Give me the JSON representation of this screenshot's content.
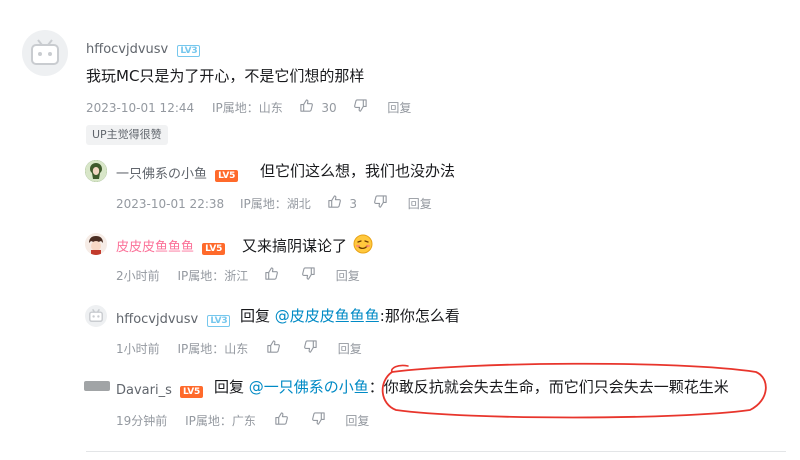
{
  "main_comment": {
    "username": "hffocvjdvusv",
    "level": "LV3",
    "text": "我玩MC只是为了开心，不是它们想的那样",
    "time": "2023-10-01 12:44",
    "ip": "IP属地：山东",
    "likes": "30",
    "reply_label": "回复",
    "up_badge": "UP主觉得很赞"
  },
  "replies": [
    {
      "username": "一只佛系の小鱼",
      "level": "LV5",
      "text": "但它们这么想，我们也没办法",
      "time": "2023-10-01 22:38",
      "ip": "IP属地：湖北",
      "likes": "3",
      "reply_label": "回复"
    },
    {
      "username": "皮皮皮鱼鱼鱼",
      "level": "LV5",
      "text": "又来搞阴谋论了",
      "time": "2小时前",
      "ip": "IP属地：浙江",
      "reply_label": "回复"
    },
    {
      "username": "hffocvjdvusv",
      "level": "LV3",
      "reply_prefix": "回复 ",
      "mention": "@皮皮皮鱼鱼鱼",
      "text": ":那你怎么看",
      "time": "1小时前",
      "ip": "IP属地：山东",
      "reply_label": "回复"
    },
    {
      "username": "Davari_s",
      "level": "LV5",
      "reply_prefix": "回复 ",
      "mention": "@一只佛系の小鱼",
      "text": "：你敢反抗就会失去生命，而它们只会失去一颗花生米",
      "time": "19分钟前",
      "ip": "IP属地：广东",
      "reply_label": "回复"
    }
  ],
  "colors": {
    "mention": "#008ac5",
    "level_orange": "#ff6a2b",
    "level_blue": "#76c7ed",
    "annotation_circle": "#e8352c",
    "pink_username": "#fb7299"
  },
  "icons": {
    "like": "thumbs-up-icon",
    "dislike": "thumbs-down-icon",
    "avatar_default": "bilibili-tv-avatar-icon",
    "emoji": "smirk-emoji-icon"
  }
}
